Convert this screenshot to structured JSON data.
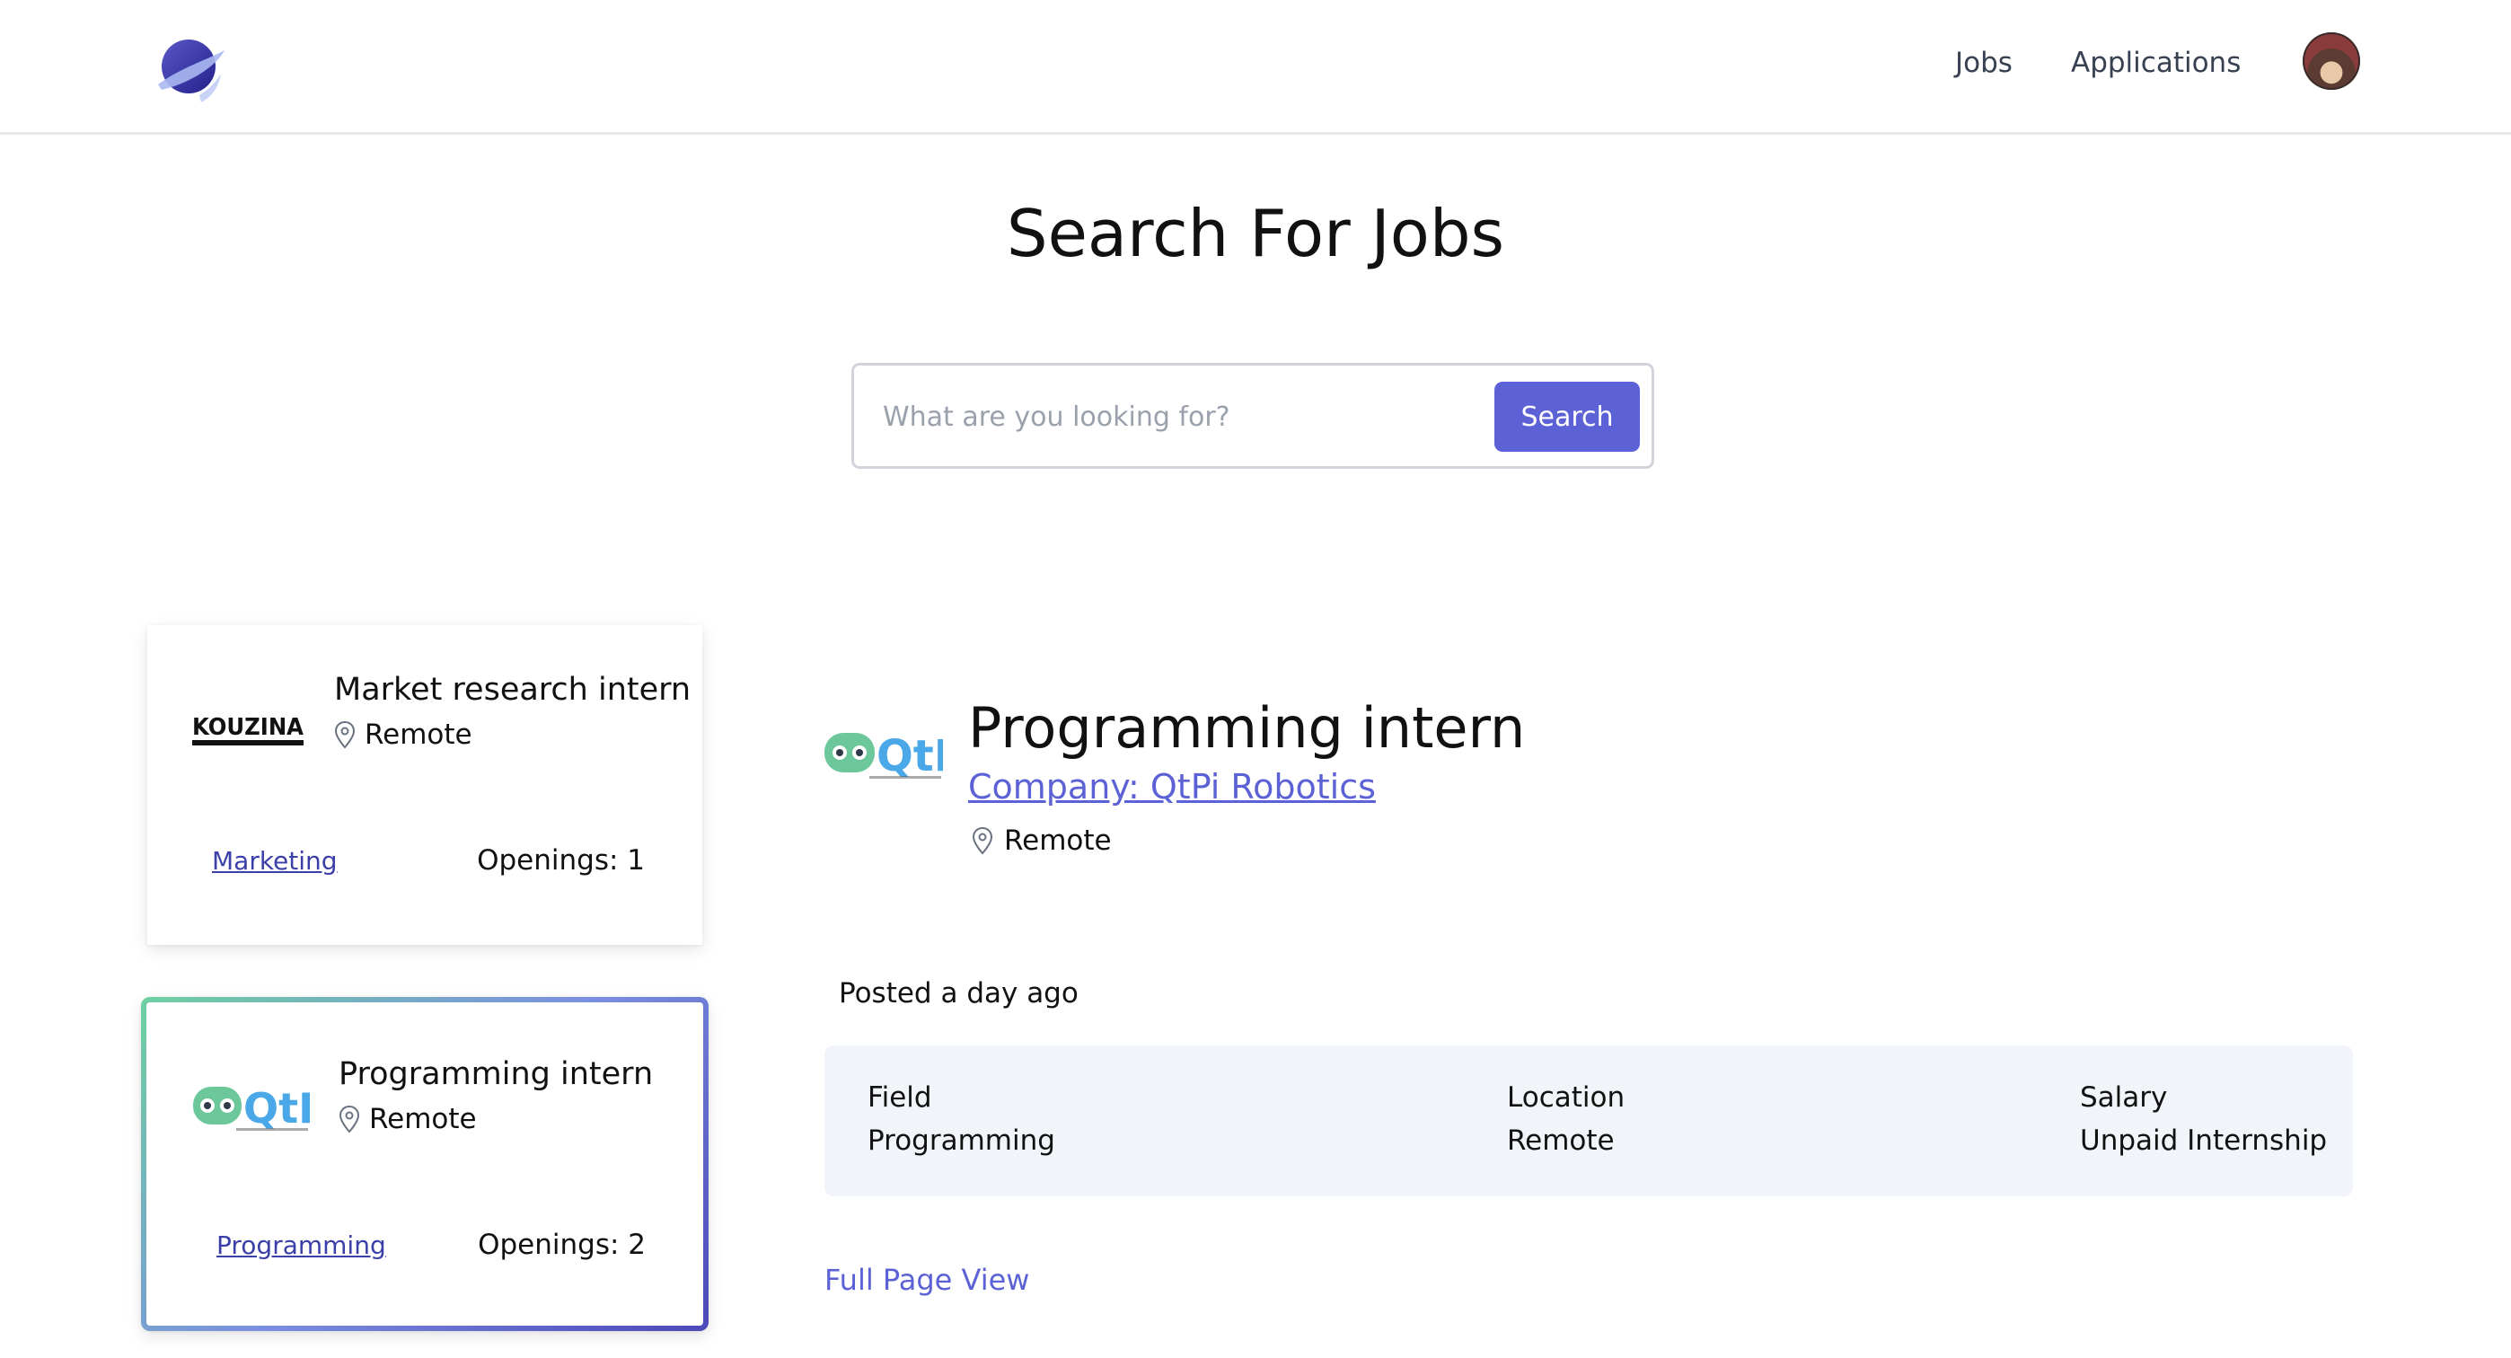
{
  "nav": {
    "jobs": "Jobs",
    "applications": "Applications"
  },
  "page": {
    "title": "Search For Jobs"
  },
  "search": {
    "placeholder": "What are you looking for?",
    "value": "",
    "button": "Search"
  },
  "jobs": [
    {
      "company_logo": "KOUZINA",
      "title": "Market research intern",
      "location": "Remote",
      "field": "Marketing",
      "openings": "Openings: 1",
      "selected": false
    },
    {
      "company_logo": "QtPi",
      "title": "Programming intern",
      "location": "Remote",
      "field": "Programming",
      "openings": "Openings: 2",
      "selected": true
    }
  ],
  "detail": {
    "title": "Programming intern",
    "company": "Company: QtPi Robotics",
    "location": "Remote",
    "posted": "Posted a day ago",
    "field_label": "Field",
    "field_value": "Programming",
    "location_label": "Location",
    "location_value": "Remote",
    "salary_label": "Salary",
    "salary_value": "Unpaid Internship",
    "full_page_link": "Full Page View"
  },
  "colors": {
    "accent": "#5c62d6",
    "tag_link": "#3b3fa8",
    "panel_bg": "#f1f4f8",
    "border": "#d1d5db"
  },
  "icons": [
    "planet-logo-icon",
    "location-pin-icon",
    "user-avatar"
  ]
}
